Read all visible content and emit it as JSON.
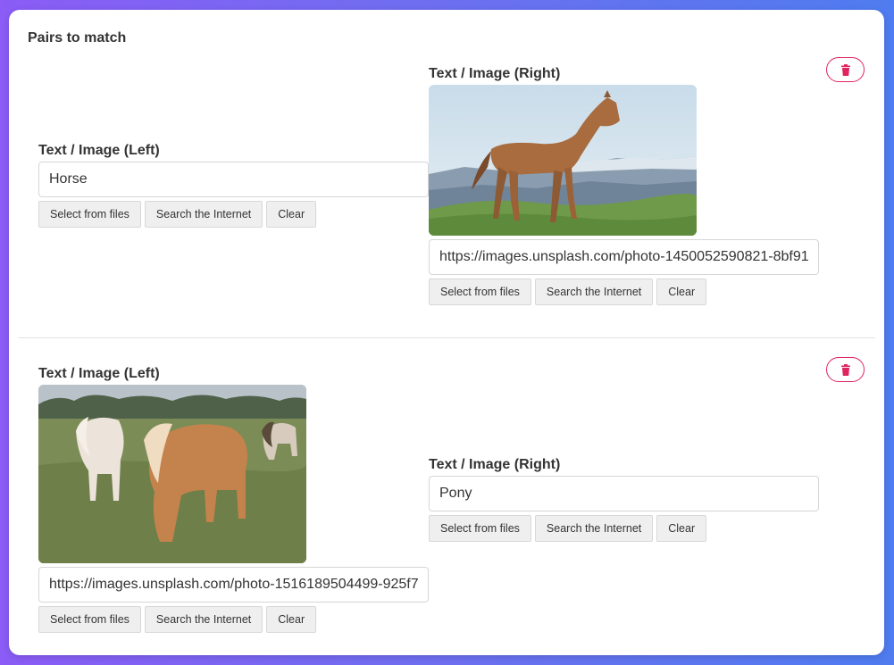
{
  "section_title": "Pairs to match",
  "pairs": [
    {
      "left": {
        "label": "Text / Image (Left)",
        "value": "Horse",
        "buttons": [
          "Select from files",
          "Search the Internet",
          "Clear"
        ]
      },
      "right": {
        "label": "Text / Image (Right)",
        "value": "https://images.unsplash.com/photo-1450052590821-8bf91",
        "buttons": [
          "Select from files",
          "Search the Internet",
          "Clear"
        ]
      }
    },
    {
      "left": {
        "label": "Text / Image (Left)",
        "value": "https://images.unsplash.com/photo-1516189504499-925f7",
        "buttons": [
          "Select from files",
          "Search the Internet",
          "Clear"
        ]
      },
      "right": {
        "label": "Text / Image (Right)",
        "value": "Pony",
        "buttons": [
          "Select from files",
          "Search the Internet",
          "Clear"
        ]
      }
    }
  ],
  "colors": {
    "delete_accent": "#e0245e"
  },
  "icons": {
    "delete": "trash-icon"
  }
}
